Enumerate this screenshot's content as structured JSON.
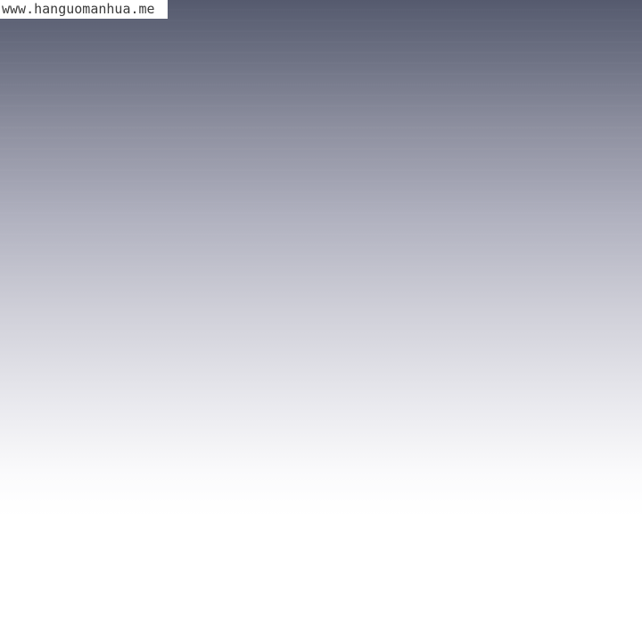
{
  "watermark": {
    "text": "www.hanguomanhua.me"
  }
}
